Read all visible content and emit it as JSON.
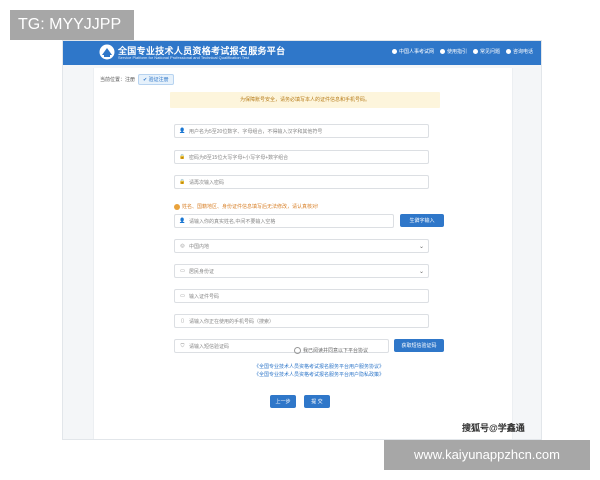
{
  "watermark": {
    "tag": "TG: MYYJJPP",
    "source": "搜狐号@学鑫通",
    "url": "www.kaiyunappzhcn.com"
  },
  "header": {
    "title_cn": "全国专业技术人员资格考试报名服务平台",
    "title_en": "Service Platform for National Professional and Technical Qualification Test",
    "nav": [
      "中国人事考试网",
      "使用指引",
      "常见问题",
      "咨询电话"
    ],
    "color": "#2f77c9"
  },
  "breadcrumb": {
    "label": "当前位置：注册",
    "step": "验证注册"
  },
  "notice": "为保障账号安全，请务必填写本人的证件信息和手机号码。",
  "form": {
    "username_placeholder": "用户名为5至20位数字、字母组合，不得输入汉字和其他符号",
    "password_placeholder": "密码为8至15位大写字母+小写字母+数字组合",
    "confirm_password_placeholder": "请再次输入密码",
    "warning": "姓名、国籍地区、身份证件信息填写后无法修改，请认真核对!",
    "name_placeholder": "请输入你的真实姓名,中间不要输入空格",
    "rare_char_button": "生僻字输入",
    "region_value": "中国内地",
    "id_type_value": "居民身份证",
    "id_number_placeholder": "输入证件号码",
    "phone_placeholder": "请输入你正在使用的手机号码（搜索）",
    "sms_placeholder": "请输入短信验证码",
    "sms_button": "获取短信验证码",
    "agree_label": "我已阅读并同意以下平台协议",
    "agreement_links": [
      "《全国专业技术人员资格考试报名服务平台用户服务协议》",
      "《全国专业技术人员资格考试报名服务平台用户隐私政策》"
    ],
    "prev_button": "上一步",
    "submit_button": "提 交"
  }
}
